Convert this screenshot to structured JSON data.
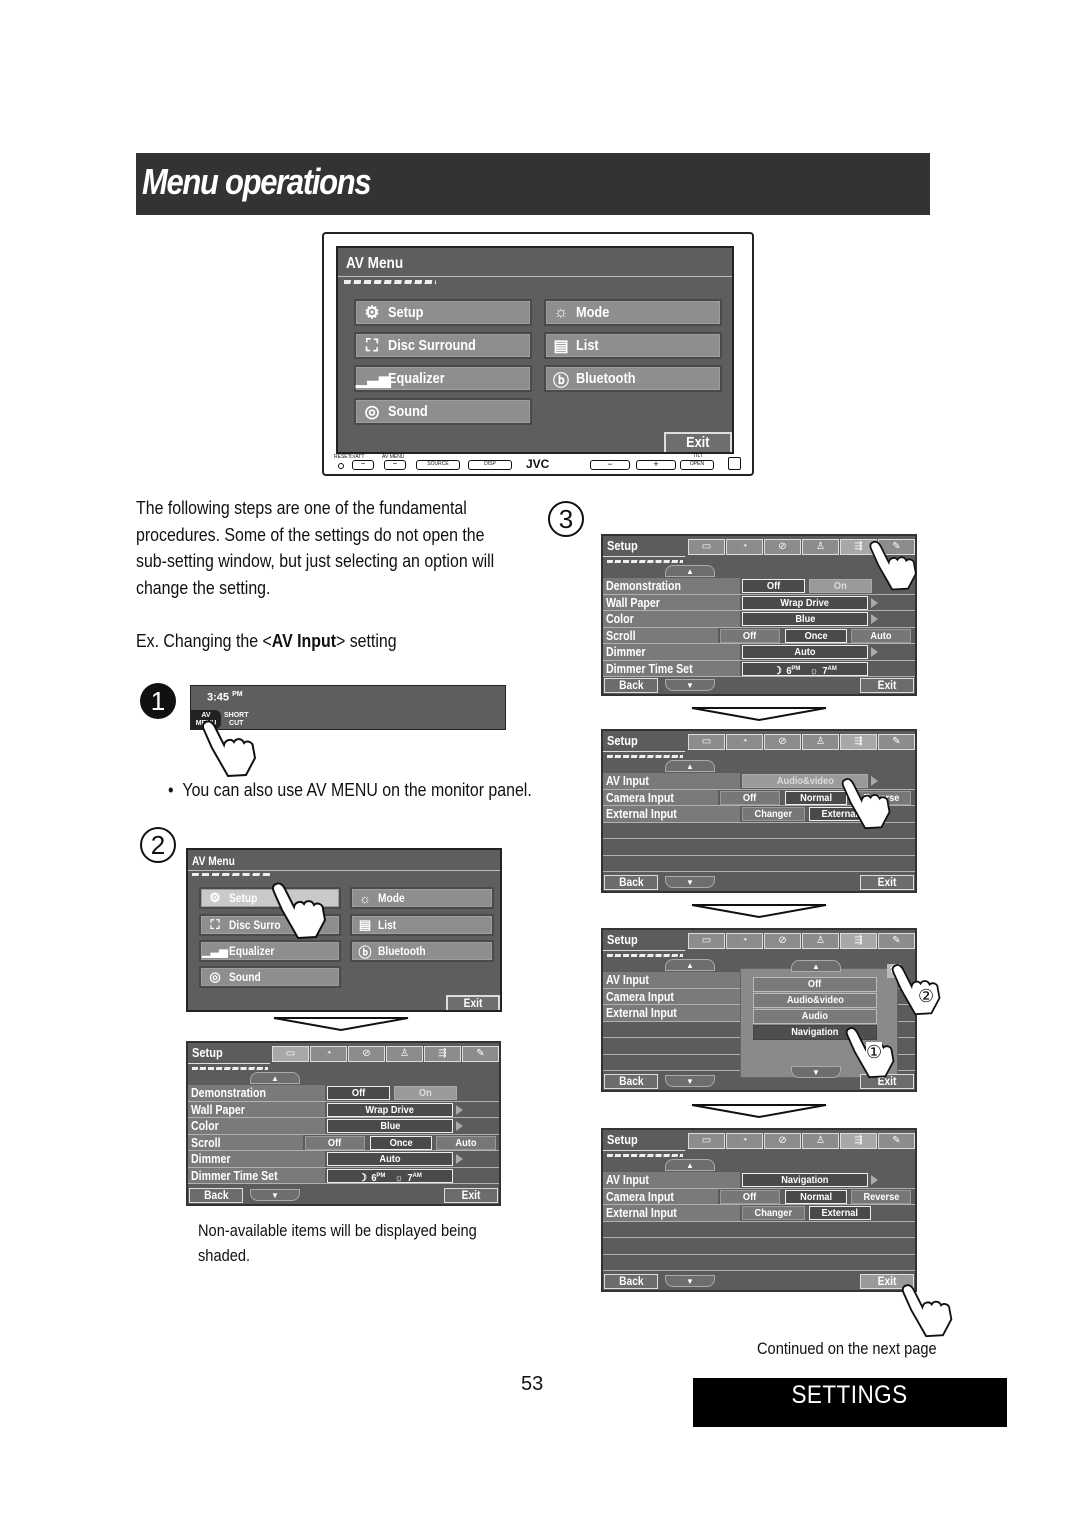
{
  "page": {
    "title": "Menu operations",
    "intro": [
      "The following steps are one of the fundamental",
      "procedures. Some of the settings do not open the",
      "sub-setting window, but just selecting an option will",
      "change the setting."
    ],
    "example_prefix": "Ex. Changing the <",
    "example_bold": "AV Input",
    "example_suffix": "> setting",
    "step_labels": [
      "1",
      "2",
      "3"
    ],
    "note_step1": "You can also use AV MENU on the monitor panel.",
    "bullet": "•",
    "note_shaded": [
      "Non-available items will be displayed being",
      "shaded."
    ],
    "continued": "Continued on the next page",
    "page_number": "53",
    "section": "SETTINGS"
  },
  "device": {
    "screen_title": "AV Menu",
    "menu_left": [
      {
        "label": "Setup",
        "icon": "gears-icon"
      },
      {
        "label": "Disc Surround",
        "icon": "surround-icon"
      },
      {
        "label": "Equalizer",
        "icon": "equalizer-icon"
      },
      {
        "label": "Sound",
        "icon": "sound-icon"
      }
    ],
    "menu_right": [
      {
        "label": "Mode",
        "icon": "mode-icon"
      },
      {
        "label": "List",
        "icon": "list-icon"
      },
      {
        "label": "Bluetooth",
        "icon": "bluetooth-icon"
      }
    ],
    "exit": "Exit",
    "buttons": {
      "reset": "RESET",
      "att": "⏻/ATT",
      "avmenu": "AV MENU",
      "source": "SOURCE",
      "disp": "DISP",
      "brand": "JVC",
      "minus": "−",
      "plus": "+",
      "tilt": "TILT",
      "open": "OPEN"
    }
  },
  "step1": {
    "time": "3:45",
    "ampm": "PM",
    "av_menu": [
      "AV",
      "MENU"
    ],
    "short_cut": [
      "SHORT",
      "CUT"
    ]
  },
  "step2": {
    "screen_title": "AV Menu",
    "menu_left": [
      "Setup",
      "Disc Surround",
      "Equalizer",
      "Sound"
    ],
    "menu_left_visible": [
      "Setup",
      "Disc Surro",
      "Equalizer",
      "Sound"
    ],
    "menu_right": [
      "Mode",
      "List",
      "Bluetooth"
    ],
    "exit": "Exit"
  },
  "setup_display": {
    "title": "Setup",
    "back": "Back",
    "exit": "Exit",
    "up": "▲",
    "down": "▼",
    "tabs": [
      "display-tab-icon",
      "clock-tab-icon",
      "disc-tab-icon",
      "tuner-tab-icon",
      "input-tab-icon",
      "wrench-tab-icon"
    ],
    "rows": [
      {
        "label": "Demonstration",
        "values": [
          "Off",
          "On"
        ]
      },
      {
        "label": "Wall Paper",
        "values": [
          "Wrap Drive"
        ]
      },
      {
        "label": "Color",
        "values": [
          "Blue"
        ]
      },
      {
        "label": "Scroll",
        "values": [
          "Off",
          "Once",
          "Auto"
        ]
      },
      {
        "label": "Dimmer",
        "values": [
          "Auto"
        ]
      },
      {
        "label": "Dimmer Time Set",
        "values": [
          "6PM",
          "7AM"
        ],
        "pm": "6",
        "pm_sup": "PM",
        "am": "7",
        "am_sup": "AM"
      }
    ]
  },
  "setup_input": {
    "title": "Setup",
    "rows": [
      {
        "label": "AV Input",
        "values": [
          "Audio&video"
        ]
      },
      {
        "label": "Camera Input",
        "values": [
          "Off",
          "Normal",
          "Reverse"
        ]
      },
      {
        "label": "External Input",
        "values": [
          "Changer",
          "External"
        ]
      }
    ],
    "popup_options": [
      "Off",
      "Audio&video",
      "Audio",
      "Navigation"
    ],
    "popup_selected": "Navigation",
    "callout_1": "①",
    "callout_2": "②",
    "close": "✖",
    "final_rows": [
      {
        "label": "AV Input",
        "values": [
          "Navigation"
        ]
      },
      {
        "label": "Camera Input",
        "values": [
          "Off",
          "Normal",
          "Reverse"
        ]
      },
      {
        "label": "External Input",
        "values": [
          "Changer",
          "External"
        ]
      }
    ]
  }
}
